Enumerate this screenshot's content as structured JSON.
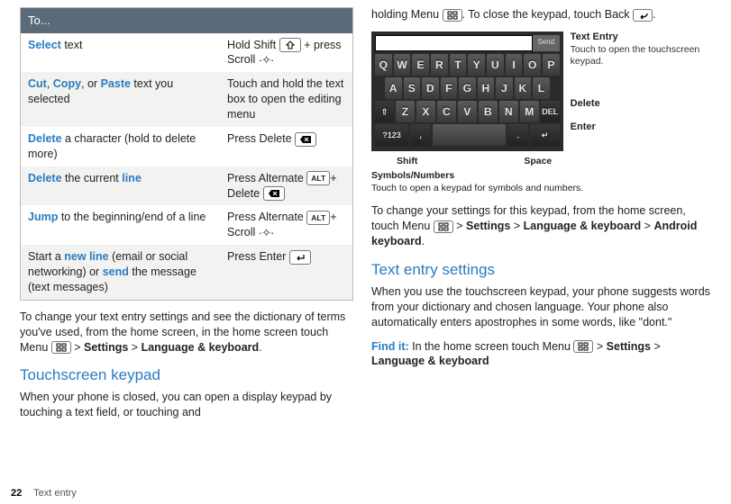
{
  "table": {
    "header": "To...",
    "rows": [
      {
        "left": {
          "pre": "",
          "accent": "Select",
          "post": " text"
        },
        "right": {
          "pre": "Hold Shift ",
          "key1": "shift",
          "mid": " + press Scroll ",
          "key2": "scroll",
          "post": ""
        }
      },
      {
        "left": {
          "accents": [
            "Cut",
            "Copy",
            "Paste"
          ],
          "seps": [
            ", ",
            ", or "
          ],
          "post": " text you selected"
        },
        "right": {
          "text": "Touch and hold the text box to open the editing menu"
        }
      },
      {
        "left": {
          "pre": "",
          "accent": "Delete",
          "post": " a character (hold to delete more)"
        },
        "right": {
          "pre": "Press Delete ",
          "key1": "delete",
          "post": ""
        }
      },
      {
        "left": {
          "pre": "",
          "accent": "Delete",
          "post": " the current ",
          "accent2": "line"
        },
        "right": {
          "pre": "Press Alternate ",
          "key1": "ALT",
          "mid": "+ Delete ",
          "key2": "delete",
          "post": ""
        }
      },
      {
        "left": {
          "pre": "",
          "accent": "Jump",
          "post": " to the beginning/end of a line"
        },
        "right": {
          "pre": "Press Alternate ",
          "key1": "ALT",
          "mid": "+ Scroll ",
          "key2": "scroll",
          "post": ""
        }
      },
      {
        "left": {
          "pre": "Start a ",
          "accent": "new line",
          "mid": " (email or social networking) or ",
          "accent2": "send",
          "post": " the message (text messages)"
        },
        "right": {
          "pre": "Press Enter ",
          "key1": "enter",
          "post": ""
        }
      }
    ]
  },
  "left_body": {
    "p1a": "To change your text entry settings and see the dictionary of terms you've used, from the home screen, in the home screen touch Menu ",
    "p1b": " > ",
    "p1c": "Settings",
    "p1d": " > ",
    "p1e": "Language & keyboard",
    "p1f": ".",
    "h1": "Touchscreen keypad",
    "p2": "When your phone is closed, you can open a display keypad by touching a text field, or touching and"
  },
  "right_body": {
    "p0a": "holding Menu ",
    "p0b": ". To close the keypad, touch Back ",
    "p0c": ".",
    "annot": {
      "textentry_lbl": "Text Entry",
      "textentry_sub": "Touch to open the touchscreen keypad.",
      "delete": "Delete",
      "enter": "Enter",
      "shift": "Shift",
      "space": "Space",
      "symnum_lbl": "Symbols/Numbers",
      "symnum_sub": "Touch to open a keypad for symbols and numbers."
    },
    "keypad": {
      "send": "Send",
      "r1": [
        "Q",
        "W",
        "E",
        "R",
        "T",
        "Y",
        "U",
        "I",
        "O",
        "P"
      ],
      "r2": [
        "A",
        "S",
        "D",
        "F",
        "G",
        "H",
        "J",
        "K",
        "L"
      ],
      "r3": [
        "⇧",
        "Z",
        "X",
        "C",
        "V",
        "B",
        "N",
        "M",
        "DEL"
      ],
      "r4": [
        "?123",
        ",",
        "",
        "․",
        "↵"
      ]
    },
    "p1a": "To change your settings for this keypad, from the home screen, touch Menu ",
    "p1b": " > ",
    "p1c": "Settings",
    "p1d": " > ",
    "p1e": "Language & keyboard",
    "p1f": " > ",
    "p1g": "Android keyboard",
    "p1h": ".",
    "h1": "Text entry settings",
    "p2": "When you use the touchscreen keypad, your phone suggests words from your dictionary and chosen language. Your phone also automatically enters apostrophes in some words, like \"dont.\"",
    "p3a": "Find it:",
    "p3b": " In the home screen touch Menu ",
    "p3c": " > ",
    "p3d": "Settings",
    "p3e": " > ",
    "p3f": "Language & keyboard"
  },
  "footer": {
    "page": "22",
    "section": "Text entry"
  }
}
